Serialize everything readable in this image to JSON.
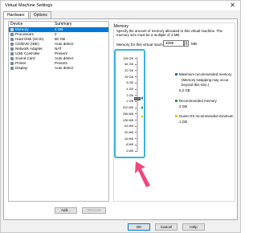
{
  "window": {
    "title": "Virtual Machine Settings",
    "close_glyph": "✕"
  },
  "tabs": [
    {
      "label": "Hardware"
    },
    {
      "label": "Options"
    }
  ],
  "devices": {
    "headers": {
      "device": "Device",
      "summary": "Summary"
    },
    "rows": [
      {
        "name": "Memory",
        "summary": "4 GB",
        "icon": "memory-icon"
      },
      {
        "name": "Processors",
        "summary": "2",
        "icon": "processor-icon"
      },
      {
        "name": "Hard Disk (SCSI)",
        "summary": "80 GB",
        "icon": "hard-disk-icon"
      },
      {
        "name": "CD/DVD (IDE)",
        "summary": "Auto detect",
        "icon": "cd-dvd-icon"
      },
      {
        "name": "Network Adapter",
        "summary": "NAT",
        "icon": "network-adapter-icon"
      },
      {
        "name": "USB Controller",
        "summary": "Present",
        "icon": "usb-controller-icon"
      },
      {
        "name": "Sound Card",
        "summary": "Auto detect",
        "icon": "sound-card-icon"
      },
      {
        "name": "Printer",
        "summary": "Present",
        "icon": "printer-icon"
      },
      {
        "name": "Display",
        "summary": "Auto detect",
        "icon": "display-icon"
      }
    ],
    "add_label": "Add...",
    "remove_label": "Remove"
  },
  "memory": {
    "group_title": "Memory",
    "description": "Specify the amount of memory allocated to this virtual machine. The memory size must be a multiple of 4 MB.",
    "field_label": "Memory for this virtual machine:",
    "value": "4096",
    "unit": "MB",
    "scale_labels": [
      "128 GB",
      "64 GB",
      "32 GB",
      "16 GB",
      "8 GB",
      "4 GB",
      "2 GB",
      "1 GB",
      "512 MB",
      "256 MB",
      "128 MB",
      "64 MB",
      "32 MB",
      "16 MB",
      "8 MB",
      "4 MB"
    ],
    "legend": {
      "max_title": "Maximum recommended memory",
      "max_note": "(Memory swapping may occur beyond this size.)",
      "max_value": "6.2 GB",
      "rec_title": "Recommended memory",
      "rec_value": "2 GB",
      "min_title": "Guest OS recommended minimum",
      "min_value": "1 GB"
    },
    "colors": {
      "max": "#2e6fb7",
      "recommended": "#2f9e3e",
      "minimum": "#e9c400",
      "highlight": "#37b4e0",
      "arrow": "#f0467a"
    }
  },
  "footer": {
    "ok_label": "OK",
    "cancel_label": "Cancel",
    "help_label": "Help"
  }
}
